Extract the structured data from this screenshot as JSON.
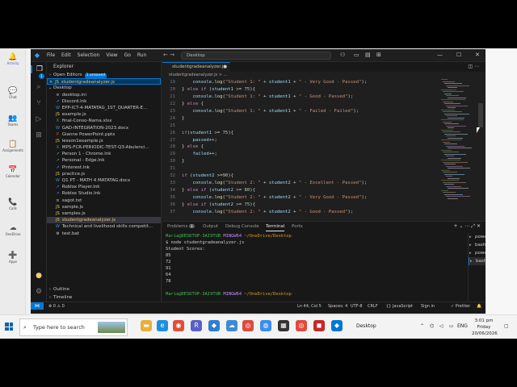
{
  "teams": {
    "rail": [
      {
        "name": "activity",
        "label": "Activity",
        "icon": "🔔"
      },
      {
        "name": "chat",
        "label": "Chat",
        "icon": "💬"
      },
      {
        "name": "teams",
        "label": "Teams",
        "icon": "👥"
      },
      {
        "name": "assignments",
        "label": "Assignments",
        "icon": "📋"
      },
      {
        "name": "calendar",
        "label": "Calendar",
        "icon": "📅"
      },
      {
        "name": "calls",
        "label": "Calls",
        "icon": "📞"
      },
      {
        "name": "onedrive",
        "label": "OneDrive",
        "icon": "☁"
      },
      {
        "name": "apps",
        "label": "Apps",
        "icon": "➕"
      }
    ]
  },
  "vscode": {
    "menu": [
      "File",
      "Edit",
      "Selection",
      "View",
      "Go",
      "Run"
    ],
    "command_center": "Desktop",
    "explorer_title": "Explorer",
    "open_editors_label": "Open Editors",
    "open_editors_badge": "1 unsaved",
    "open_file": "studentgradeanalyzer.js",
    "desktop_label": "Desktop",
    "files": [
      {
        "name": "desktop.ini",
        "type": "txt"
      },
      {
        "name": "Discord.lnk",
        "type": "lnk"
      },
      {
        "name": "EPP-ICT-4-MATATAG_1ST_QUARTER-E...",
        "type": "doc"
      },
      {
        "name": "example.js",
        "type": "js"
      },
      {
        "name": "final-Conso-Nama.xlsx",
        "type": "xls"
      },
      {
        "name": "GAD-INTEGRATION-2023.docx",
        "type": "doc"
      },
      {
        "name": "Gianne PowerPoint.pptx",
        "type": "ppt"
      },
      {
        "name": "lesson1example.js",
        "type": "js"
      },
      {
        "name": "MPS-FCR-PERIODIC-TEST-Q3-Abulenci...",
        "type": "xls"
      },
      {
        "name": "Person 1 - Chrome.lnk",
        "type": "lnk"
      },
      {
        "name": "Personal - Edge.lnk",
        "type": "lnk"
      },
      {
        "name": "Pinterest.lnk",
        "type": "lnk"
      },
      {
        "name": "practice.js",
        "type": "js"
      },
      {
        "name": "Q1 PT - MATH 4 MATATAG.docx",
        "type": "doc"
      },
      {
        "name": "Roblox Player.lnk",
        "type": "lnk"
      },
      {
        "name": "Roblox Studio.lnk",
        "type": "lnk"
      },
      {
        "name": "sagot.txt",
        "type": "txt"
      },
      {
        "name": "sample.js",
        "type": "js"
      },
      {
        "name": "samples.js",
        "type": "js"
      },
      {
        "name": "studentgradeanalyzer.js",
        "type": "js",
        "selected": true
      },
      {
        "name": "Technical and livelihood skills competit...",
        "type": "doc"
      },
      {
        "name": "test.bat",
        "type": "bat"
      }
    ],
    "outline_label": "Outline",
    "timeline_label": "Timeline",
    "tab_label": "studentgradeanalyzer.js",
    "breadcrumb": "studentgradeanalyzer.js > ...",
    "code_lines": [
      {
        "n": "19",
        "html": "    <span class=\"var\">console</span>.<span class=\"fn\">log</span>(<span class=\"str\">\"Student 1: \"</span> + <span class=\"var\">student1</span> + <span class=\"str\">\" - Very Good - Passed\"</span>);"
      },
      {
        "n": "20",
        "html": "} <span class=\"kw\">else if</span> (<span class=\"var\">student1</span> &gt;= <span class=\"num\">75</span>){"
      },
      {
        "n": "21",
        "html": "    <span class=\"var\">console</span>.<span class=\"fn\">log</span>(<span class=\"str\">\"Student 1: \"</span> + <span class=\"var\">student1</span> + <span class=\"str\">\" - Good - Passed\"</span>);"
      },
      {
        "n": "22",
        "html": "} <span class=\"kw\">else</span> {"
      },
      {
        "n": "23",
        "html": "    <span class=\"var\">console</span>.<span class=\"fn\">log</span>(<span class=\"str\">\"Student 1: \"</span> + <span class=\"var\">student1</span> + <span class=\"str\">\" - Failed - Failed\"</span>);"
      },
      {
        "n": "24",
        "html": "}"
      },
      {
        "n": "25",
        "html": ""
      },
      {
        "n": "26",
        "html": "<span class=\"kw\">if</span>(<span class=\"var\">student1</span> &gt;= <span class=\"num\">75</span>){"
      },
      {
        "n": "27",
        "html": "    <span class=\"var\">passed</span>++;"
      },
      {
        "n": "28",
        "html": "} <span class=\"kw\">else</span> {"
      },
      {
        "n": "29",
        "html": "    <span class=\"var\">failed</span>++;"
      },
      {
        "n": "30",
        "html": "}"
      },
      {
        "n": "31",
        "html": ""
      },
      {
        "n": "32",
        "html": "<span class=\"kw\">if</span> (<span class=\"var\">student2</span> &gt;=<span class=\"num\">90</span>){"
      },
      {
        "n": "33",
        "html": "    <span class=\"var\">console</span>.<span class=\"fn\">log</span>(<span class=\"str\">\"Student 2: \"</span> + <span class=\"var\">student2</span> + <span class=\"str\">\" - Excellent - Passed\"</span>);"
      },
      {
        "n": "34",
        "html": "} <span class=\"kw\">else if</span> (<span class=\"var\">student2</span> &gt;= <span class=\"num\">80</span>){"
      },
      {
        "n": "35",
        "html": "    <span class=\"var\">console</span>.<span class=\"fn\">log</span>(<span class=\"str\">\"Student 2: \"</span> + <span class=\"var\">student2</span> + <span class=\"str\">\" - Very Good - Passed\"</span>);"
      },
      {
        "n": "36",
        "html": "} <span class=\"kw\">else if</span> (<span class=\"var\">student2</span> &gt;= <span class=\"num\">75</span>){"
      },
      {
        "n": "37",
        "html": "    <span class=\"var\">console</span>.<span class=\"fn\">log</span>(<span class=\"str\">\"Student 2: \"</span> + <span class=\"var\">student2</span> + <span class=\"str\">\" - Good - Passed\"</span>);"
      }
    ],
    "panel_tabs": {
      "problems": "Problems",
      "problems_count": "1",
      "output": "Output",
      "debug": "Debug Console",
      "terminal": "Terminal",
      "ports": "Ports"
    },
    "terminal": {
      "prompt_user": "Maria@DESKTOP-3AI9TUB",
      "prompt_ming": "MINGW64",
      "prompt_path": "~/OneDrive/Desktop",
      "command": "$ node studentgradeanalyzer.js",
      "output_title": "Student Scores:",
      "scores": [
        "85",
        "72",
        "91",
        "64",
        "78"
      ]
    },
    "terminal_list": [
      "powershell",
      "bash",
      "powershell",
      "bash"
    ],
    "status": {
      "errors": "⊗ 0 ⚠ 0",
      "position": "Ln 44, Col 5",
      "spaces": "Spaces: 4",
      "encoding": "UTF-8",
      "eol": "CRLF",
      "language": "{} JavaScript",
      "signin": "Sign in",
      "prettier": "✓ Prettier"
    }
  },
  "taskbar": {
    "search_placeholder": "Type here to search",
    "label": "Desktop",
    "language": "ENG",
    "time": "3:01 pm",
    "day": "Friday",
    "date": "20/06/2026"
  }
}
